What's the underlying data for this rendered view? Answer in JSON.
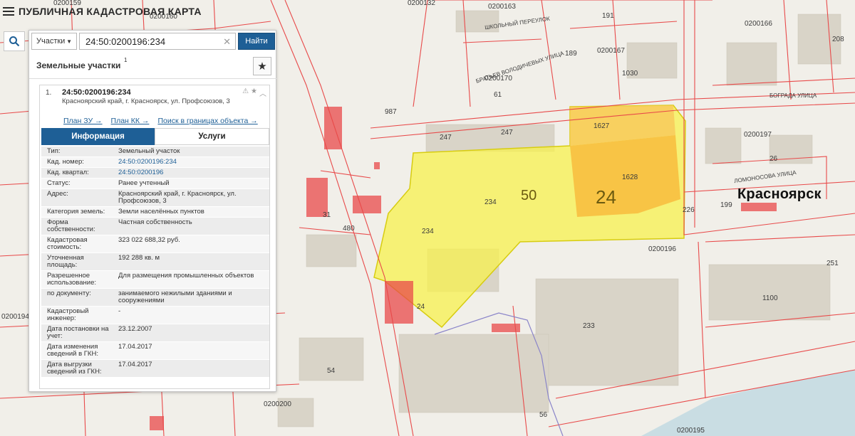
{
  "app": {
    "title": "ПУБЛИЧНАЯ КАДАСТРОВАЯ КАРТА"
  },
  "search": {
    "type_label": "Участки",
    "query": "24:50:0200196:234",
    "button_label": "Найти"
  },
  "section": {
    "title": "Земельные участки",
    "count": "1"
  },
  "result": {
    "index": "1.",
    "cad_number": "24:50:0200196:234",
    "address": "Красноярский край, г. Красноярск, ул. Профсоюзов, 3",
    "links": [
      "План ЗУ →",
      "План КК →",
      "Поиск в границах объекта →"
    ],
    "tabs": [
      "Информация",
      "Услуги"
    ],
    "rows": [
      {
        "k": "Тип:",
        "v": "Земельный участок"
      },
      {
        "k": "Кад. номер:",
        "v": "24:50:0200196:234"
      },
      {
        "k": "Кад. квартал:",
        "v": "24:50:0200196"
      },
      {
        "k": "Статус:",
        "v": "Ранее учтенный"
      },
      {
        "k": "Адрес:",
        "v": "Красноярский край, г. Красноярск, ул. Профсоюзов, 3"
      },
      {
        "k": "Категория земель:",
        "v": "Земли населённых пунктов"
      },
      {
        "k": "Форма собственности:",
        "v": "Частная собственность"
      },
      {
        "k": "Кадастровая стоимость:",
        "v": "323 022 688,32 руб."
      },
      {
        "k": "Уточненная площадь:",
        "v": "192 288 кв. м"
      },
      {
        "k": "Разрешенное использование:",
        "v": "Для размещения промышленных объектов"
      },
      {
        "k": "по документу:",
        "v": "занимаемого нежилыми зданиями и сооружениями"
      },
      {
        "k": "Кадастровый инженер:",
        "v": "-"
      },
      {
        "k": "Дата постановки на учет:",
        "v": "23.12.2007"
      },
      {
        "k": "Дата изменения сведений в ГКН:",
        "v": "17.04.2017"
      },
      {
        "k": "Дата выгрузки сведений из ГКН:",
        "v": "17.04.2017"
      }
    ]
  },
  "map": {
    "city": "Красноярск",
    "district_labels": [
      "50",
      "24"
    ],
    "quarter_labels": [
      "0200132",
      "0200163",
      "0200166",
      "0200167",
      "0200170",
      "0200197",
      "0200196",
      "0200200",
      "0200195",
      "0200159",
      "0200160",
      "0200194"
    ],
    "parcel_labels": [
      "247",
      "247",
      "234",
      "234",
      "1628",
      "1627",
      "1100",
      "233",
      "199",
      "56",
      "54",
      "31",
      "480",
      "24",
      "191",
      "189",
      "61",
      "987",
      "1030",
      "26",
      "208",
      "251",
      "226"
    ],
    "street_labels": [
      "ШКОЛЬНЫЙ ПЕРЕУЛОК",
      "БРАТЬЕВ ВОЛОДИЧЕВЫХ УЛИЦА",
      "БОГРАДА УЛИЦА",
      "ЛОМОНОСОВА УЛИЦА"
    ],
    "colors": {
      "background": "#f1efe9",
      "parcel_stroke": "#e84a4a",
      "building": "#d9d4c8",
      "highlight_parcel": "#f7f24e",
      "highlight_inner": "#f9b93a",
      "water": "#c9dde3",
      "accent": "#1e5f96"
    }
  }
}
